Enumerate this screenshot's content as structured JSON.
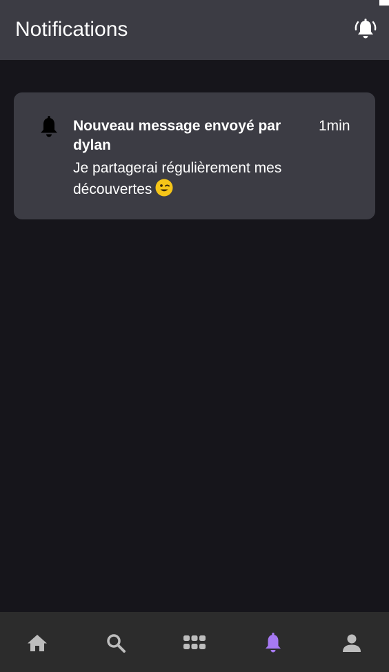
{
  "header": {
    "title": "Notifications",
    "action_icon": "bell-ring-icon"
  },
  "notifications": [
    {
      "icon": "bell-icon",
      "title": "Nouveau message envoyé par dylan",
      "time": "1min",
      "body": "Je partagerai régulièrement mes découvertes",
      "emoji": "winking-face-emoji"
    }
  ],
  "bottom_nav": {
    "items": [
      {
        "icon": "home-icon",
        "active": false
      },
      {
        "icon": "search-icon",
        "active": false
      },
      {
        "icon": "apps-grid-icon",
        "active": false
      },
      {
        "icon": "bell-icon",
        "active": true
      },
      {
        "icon": "user-icon",
        "active": false
      }
    ]
  },
  "colors": {
    "background": "#16151b",
    "surface": "#3c3c44",
    "nav_background": "#2c2c2c",
    "nav_icon": "#bdbdbd",
    "accent": "#a679f2",
    "text": "#ffffff"
  }
}
